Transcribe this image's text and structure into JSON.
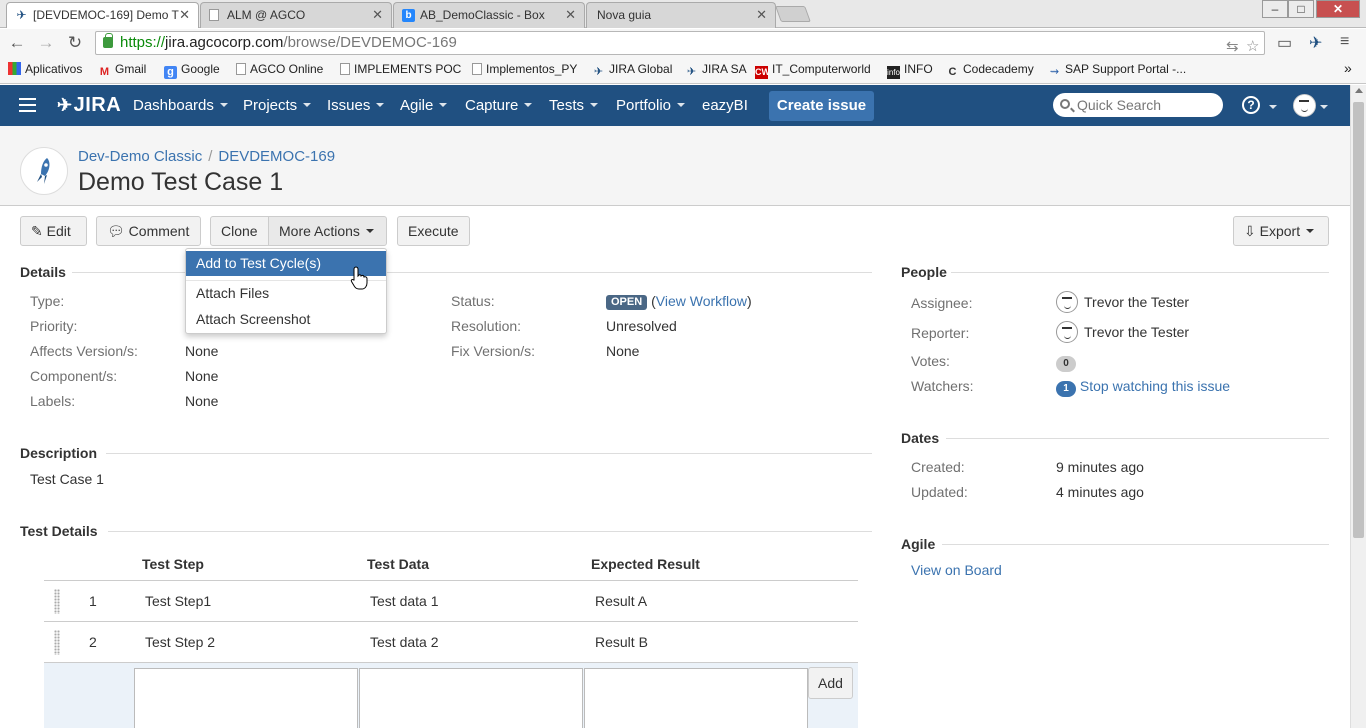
{
  "browser": {
    "tabs": [
      {
        "title": "[DEVDEMOC-169] Demo T",
        "icon": "jira-icon",
        "active": true
      },
      {
        "title": "ALM @ AGCO",
        "icon": "page-icon",
        "active": false
      },
      {
        "title": "AB_DemoClassic - Box",
        "icon": "box-icon",
        "active": false
      },
      {
        "title": "Nova guia",
        "icon": "",
        "active": false
      }
    ],
    "window_controls": {
      "minimize": "–",
      "maximize": "□",
      "close": "✕"
    },
    "url": {
      "scheme": "https://",
      "domain": "jira.agcocorp.com",
      "path": "/browse/DEVDEMOC-169"
    },
    "bookmarks": [
      {
        "label": "Aplicativos",
        "icon": "apps-icon"
      },
      {
        "label": "Gmail",
        "icon": "gmail-icon"
      },
      {
        "label": "Google",
        "icon": "google-icon"
      },
      {
        "label": "AGCO Online",
        "icon": "page-icon"
      },
      {
        "label": "IMPLEMENTS POC",
        "icon": "page-icon"
      },
      {
        "label": "Implementos_PY",
        "icon": "page-icon"
      },
      {
        "label": "JIRA Global",
        "icon": "jira-icon"
      },
      {
        "label": "JIRA SA",
        "icon": "jira-icon"
      },
      {
        "label": "IT_Computerworld",
        "icon": "cw-icon"
      },
      {
        "label": "INFO",
        "icon": "info-icon"
      },
      {
        "label": "Codecademy",
        "icon": "codecademy-icon"
      },
      {
        "label": "SAP Support Portal -...",
        "icon": "sap-icon"
      }
    ],
    "bookmarks_overflow": "»"
  },
  "jira_header": {
    "logo": "JIRA",
    "nav": [
      "Dashboards",
      "Projects",
      "Issues",
      "Agile",
      "Capture",
      "Tests",
      "Portfolio",
      "eazyBI"
    ],
    "create_label": "Create issue",
    "search_placeholder": "Quick Search",
    "help": "?"
  },
  "issue": {
    "breadcrumb_project": "Dev-Demo Classic",
    "breadcrumb_sep": "/",
    "breadcrumb_key": "DEVDEMOC-169",
    "summary": "Demo Test Case 1"
  },
  "actions": {
    "edit": "Edit",
    "comment": "Comment",
    "clone": "Clone",
    "more": "More Actions",
    "execute": "Execute",
    "export": "Export"
  },
  "more_actions_menu": [
    "Add to Test Cycle(s)",
    "Attach Files",
    "Attach Screenshot"
  ],
  "details": {
    "title": "Details",
    "type_label": "Type:",
    "priority_label": "Priority:",
    "affects_label": "Affects Version/s:",
    "affects_value": "None",
    "component_label": "Component/s:",
    "component_value": "None",
    "labels_label": "Labels:",
    "labels_value": "None",
    "status_label": "Status:",
    "status_value": "OPEN",
    "view_workflow": "View Workflow",
    "resolution_label": "Resolution:",
    "resolution_value": "Unresolved",
    "fix_label": "Fix Version/s:",
    "fix_value": "None"
  },
  "description": {
    "title": "Description",
    "text": "Test Case 1"
  },
  "test_details": {
    "title": "Test Details",
    "columns": [
      "Test Step",
      "Test Data",
      "Expected Result"
    ],
    "rows": [
      {
        "num": "1",
        "step": "Test Step1",
        "data": "Test data 1",
        "result": "Result A"
      },
      {
        "num": "2",
        "step": "Test Step 2",
        "data": "Test data 2",
        "result": "Result B"
      }
    ],
    "add_label": "Add"
  },
  "people": {
    "title": "People",
    "assignee_label": "Assignee:",
    "assignee": "Trevor the Tester",
    "reporter_label": "Reporter:",
    "reporter": "Trevor the Tester",
    "votes_label": "Votes:",
    "votes": "0",
    "watchers_label": "Watchers:",
    "watchers": "1",
    "stop_watching": "Stop watching this issue"
  },
  "dates": {
    "title": "Dates",
    "created_label": "Created:",
    "created": "9 minutes ago",
    "updated_label": "Updated:",
    "updated": "4 minutes ago"
  },
  "agile": {
    "title": "Agile",
    "view_on_board": "View on Board"
  },
  "colors": {
    "header": "#205081",
    "link": "#3b73af",
    "create": "#3b73af",
    "lozenge": "#4a6785"
  }
}
